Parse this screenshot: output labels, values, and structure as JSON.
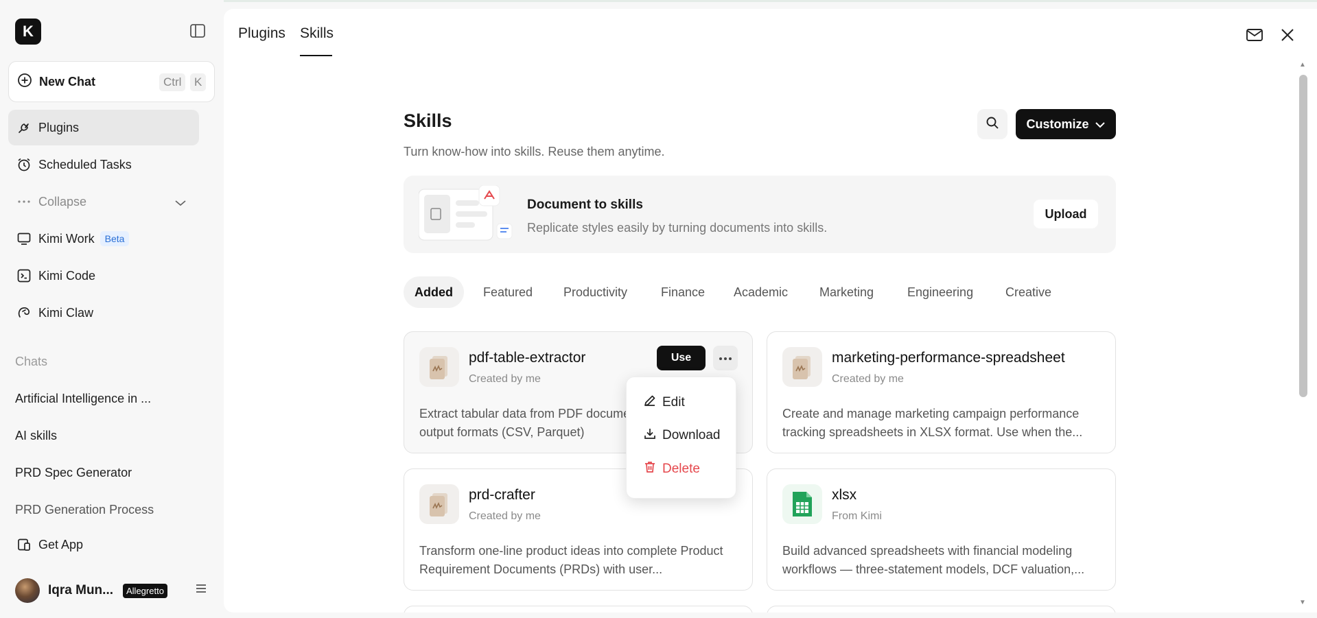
{
  "sidebar": {
    "logo_text": "K",
    "new_chat": {
      "label": "New Chat",
      "kbd1": "Ctrl",
      "kbd2": "K"
    },
    "nav": [
      {
        "label": "Plugins"
      },
      {
        "label": "Scheduled Tasks"
      },
      {
        "label": "Collapse"
      },
      {
        "label": "Kimi Work",
        "badge": "Beta"
      },
      {
        "label": "Kimi Code"
      },
      {
        "label": "Kimi Claw"
      }
    ],
    "chats_label": "Chats",
    "chats": [
      "Artificial Intelligence in ...",
      "AI skills",
      "PRD Spec Generator",
      "PRD Generation Process"
    ],
    "get_app": "Get App",
    "user": {
      "name": "Iqra Mun...",
      "plan": "Allegretto"
    }
  },
  "header": {
    "tabs": [
      {
        "label": "Plugins"
      },
      {
        "label": "Skills"
      }
    ],
    "active_tab": "Skills"
  },
  "main": {
    "title": "Skills",
    "subtitle": "Turn know-how into skills. Reuse them anytime.",
    "customize_label": "Customize",
    "banner": {
      "title": "Document to skills",
      "subtitle": "Replicate styles easily by turning documents into skills.",
      "upload_label": "Upload"
    },
    "categories": [
      "Added",
      "Featured",
      "Productivity",
      "Finance",
      "Academic",
      "Marketing",
      "Engineering",
      "Creative"
    ],
    "active_category": "Added",
    "cards": [
      {
        "name": "pdf-table-extractor",
        "meta": "Created by me",
        "desc": "Extract tabular data from PDF documents to structured output formats (CSV, Parquet)",
        "use_label": "Use"
      },
      {
        "name": "marketing-performance-spreadsheet",
        "meta": "Created by me",
        "desc": "Create and manage marketing campaign performance tracking spreadsheets in XLSX format. Use when the..."
      },
      {
        "name": "prd-crafter",
        "meta": "Created by me",
        "desc": "Transform one-line product ideas into complete Product Requirement Documents (PRDs) with user..."
      },
      {
        "name": "xlsx",
        "meta": "From Kimi",
        "desc": "Build advanced spreadsheets with financial modeling workflows — three-statement models, DCF valuation,..."
      }
    ],
    "dropdown": {
      "edit": "Edit",
      "download": "Download",
      "delete": "Delete"
    }
  },
  "colors": {
    "accent": "#111111",
    "danger": "#e5484d",
    "beta_bg": "#e6f0ff",
    "beta_text": "#2a6fd6",
    "xlsx_green": "#22a35a"
  }
}
